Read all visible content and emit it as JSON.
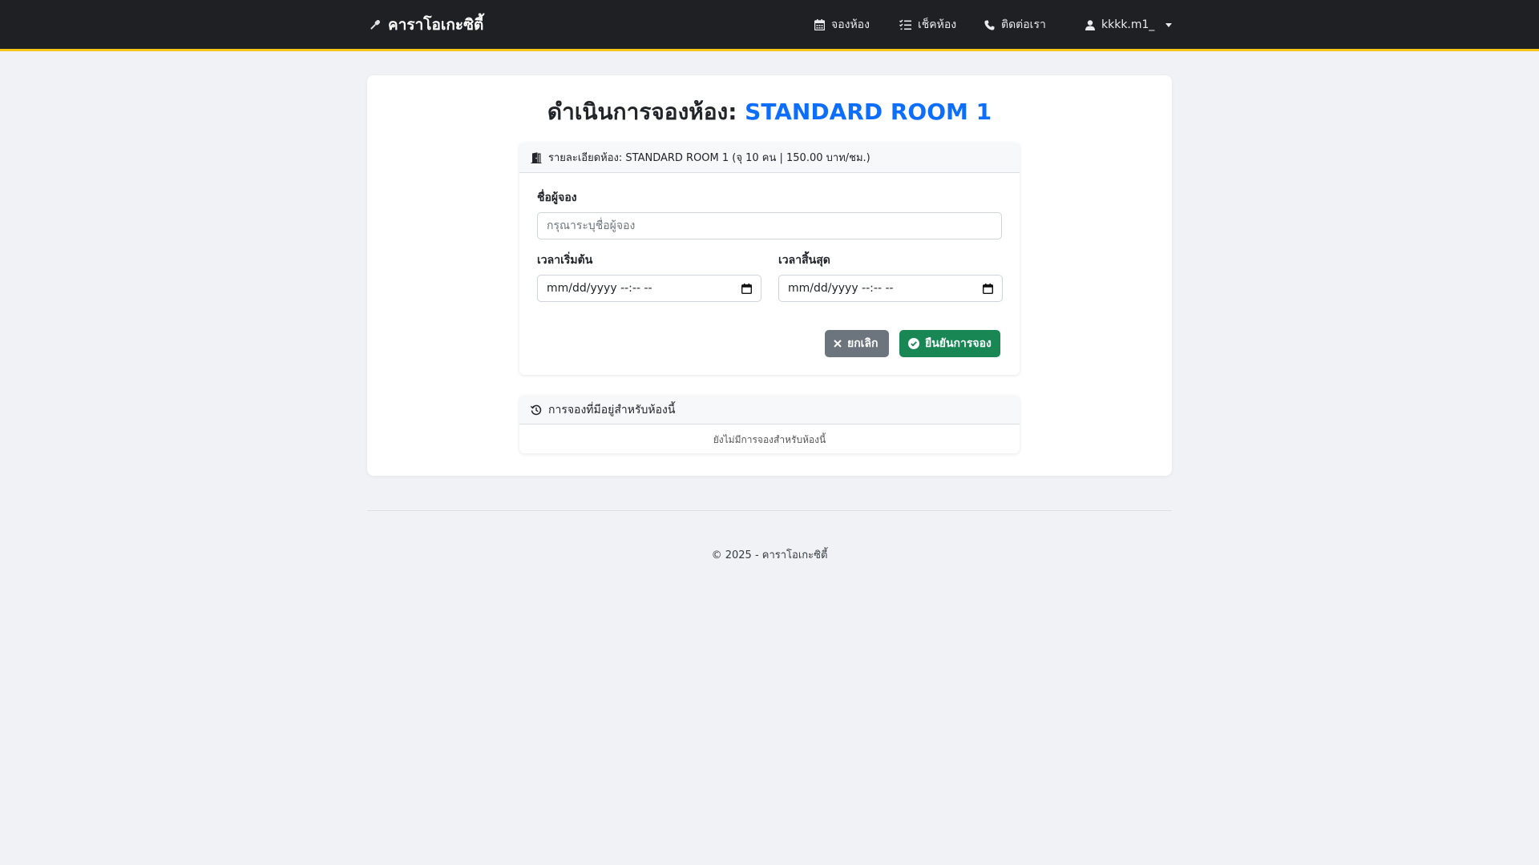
{
  "navbar": {
    "brand": "คาราโอเกะซิตี้",
    "brand_icon": "microphone-icon",
    "items": [
      {
        "label": "จองห้อง",
        "icon": "calendar-icon"
      },
      {
        "label": "เช็คห้อง",
        "icon": "list-check-icon"
      },
      {
        "label": "ติดต่อเรา",
        "icon": "phone-icon"
      }
    ],
    "user": {
      "label": "kkkk.m1_",
      "icon": "user-icon"
    },
    "accent_color": "#f5c518",
    "background_color": "#1f2023"
  },
  "main": {
    "title_prefix": "ดำเนินการจองห้อง:",
    "title_room": "STANDARD ROOM 1",
    "title_room_color": "#0d6efd",
    "room_details": "รายละเอียดห้อง: STANDARD ROOM 1 (จุ 10 คน | 150.00 บาท/ชม.)",
    "form": {
      "name_label": "ชื่อผู้จอง",
      "name_placeholder": "กรุณาระบุชื่อผู้จอง",
      "name_value": "",
      "start_label": "เวลาเริ่มต้น",
      "start_value": "mm/dd/yyyy --:-- --",
      "end_label": "เวลาสิ้นสุด",
      "end_value": "mm/dd/yyyy --:-- --",
      "cancel_label": "ยกเลิก",
      "confirm_label": "ยืนยันการจอง",
      "cancel_color": "#6c757d",
      "confirm_color": "#198754"
    },
    "existing": {
      "header": "การจองที่มีอยู่สำหรับห้องนี้",
      "empty_text": "ยังไม่มีการจองสำหรับห้องนี้"
    }
  },
  "footer": {
    "text": "© 2025 - คาราโอเกะซิตี้"
  }
}
